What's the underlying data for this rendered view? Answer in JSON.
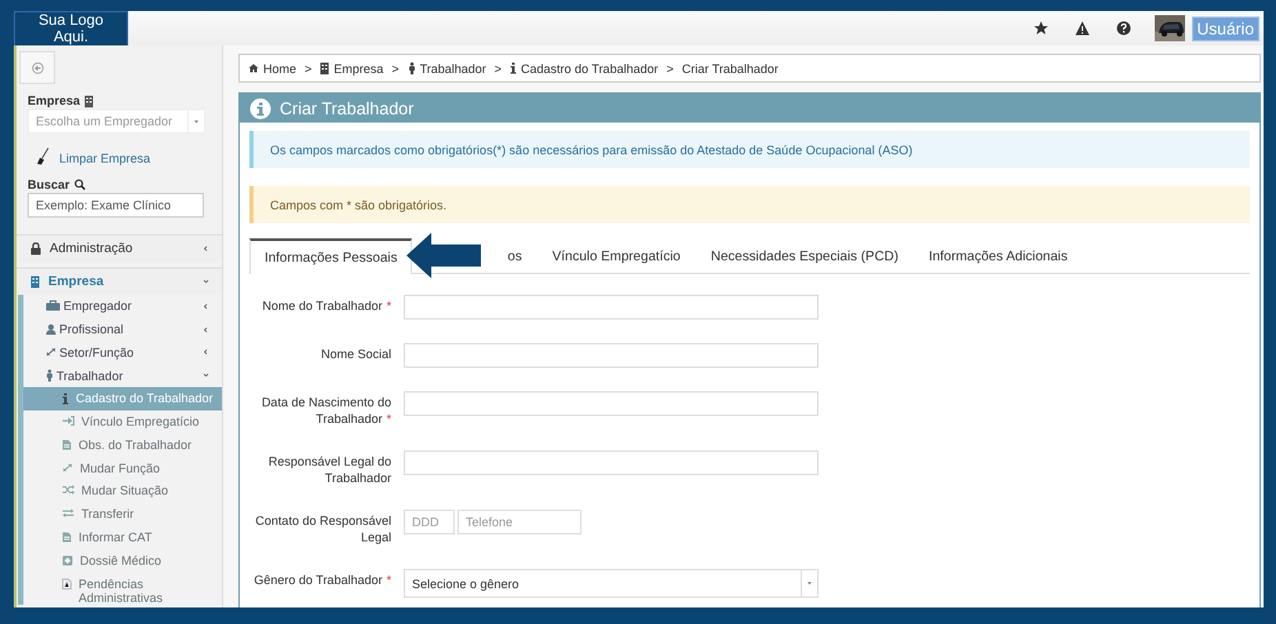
{
  "header": {
    "logo": "Sua Logo Aqui.",
    "user_button": "Usuário"
  },
  "sidebar": {
    "company_label": "Empresa",
    "company_select": {
      "placeholder": "Escolha um Empregador"
    },
    "clear_link": "Limpar Empresa",
    "search_label": "Buscar",
    "search_field": {
      "placeholder": "Exemplo: Exame Clínico"
    },
    "menu": [
      {
        "label": "Administração",
        "expanded": false
      },
      {
        "label": "Empresa",
        "expanded": true,
        "children": [
          {
            "label": "Empregador",
            "expanded": false
          },
          {
            "label": "Profissional",
            "expanded": false
          },
          {
            "label": "Setor/Função",
            "expanded": false
          },
          {
            "label": "Trabalhador",
            "expanded": true,
            "children": [
              {
                "label": "Cadastro do Trabalhador",
                "selected": true
              },
              {
                "label": "Vínculo Empregatício",
                "selected": false
              },
              {
                "label": "Obs. do Trabalhador",
                "selected": false
              },
              {
                "label": "Mudar Função",
                "selected": false
              },
              {
                "label": "Mudar Situação",
                "selected": false
              },
              {
                "label": "Transferir",
                "selected": false
              },
              {
                "label": "Informar CAT",
                "selected": false
              },
              {
                "label": "Dossiê Médico",
                "selected": false
              },
              {
                "label": "Pendências Administrativas",
                "selected": false
              }
            ]
          }
        ]
      }
    ]
  },
  "breadcrumb": {
    "separator": ">",
    "items": [
      "Home",
      "Empresa",
      "Trabalhador",
      "Cadastro do Trabalhador",
      "Criar Trabalhador"
    ]
  },
  "panel": {
    "title": "Criar Trabalhador",
    "info_alert": "Os campos marcados como obrigatórios(*) são necessários para emissão do Atestado de Saúde Ocupacional (ASO)",
    "warning_alert": "Campos com * são obrigatórios.",
    "tabs": [
      {
        "label": "Informações Pessoais",
        "selected": true
      },
      {
        "label": "os",
        "selected": false
      },
      {
        "label": "Vínculo Empregatício",
        "selected": false
      },
      {
        "label": "Necessidades Especiais (PCD)",
        "selected": false
      },
      {
        "label": "Informações Adicionais",
        "selected": false
      }
    ],
    "fields": [
      {
        "kind": "text",
        "label": "Nome do Trabalhador",
        "required_mark": "*"
      },
      {
        "kind": "text",
        "label": "Nome Social"
      },
      {
        "kind": "text",
        "label": "Data de Nascimento do Trabalhador",
        "required_mark": "*"
      },
      {
        "kind": "text",
        "label": "Responsável Legal do Trabalhador"
      },
      {
        "kind": "phone",
        "label": "Contato do Responsável Legal",
        "area_placeholder": "DDD",
        "phone_placeholder": "Telefone"
      },
      {
        "kind": "select",
        "label": "Gênero do Trabalhador",
        "required_mark": "*",
        "value": "Selecione o gênero"
      }
    ]
  }
}
